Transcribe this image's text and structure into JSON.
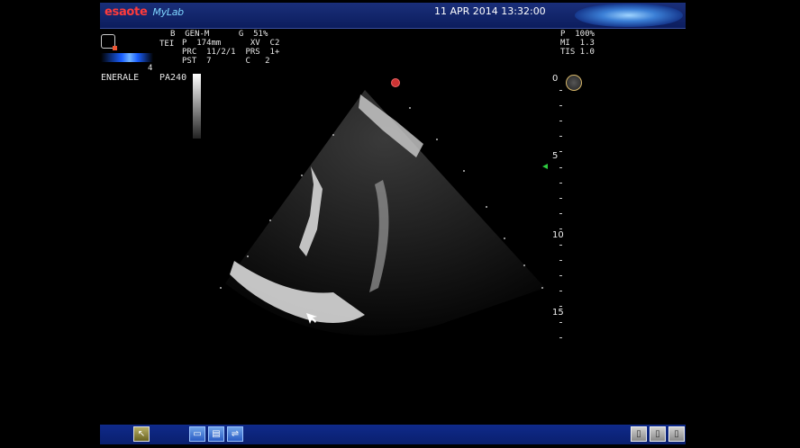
{
  "header": {
    "brand": "esaote",
    "brand_product": "MyLab",
    "datetime": "11 APR 2014 13:32:00"
  },
  "params_left": {
    "probe_label": "TEI",
    "count": "4",
    "preset": "ENERALE",
    "probe_model": "PA240"
  },
  "params_main": {
    "line1": "B  GEN-M      G  51%",
    "line2": "P  174mm      XV  C2",
    "line3": "PRC  11/2/1  PRS  1+",
    "line4": "PST  7       C   2"
  },
  "params_right": {
    "line1": "P  100%",
    "line2": "MI  1.3",
    "line3": "TIS 1.0"
  },
  "depth_scale": {
    "labels": [
      "0",
      "5",
      "10",
      "15"
    ]
  },
  "icons": {
    "probe": "probe-heart-icon",
    "orientation": "orientation-marker-icon",
    "focus": "focus-marker-icon",
    "cursor": "cursor-arrow-icon",
    "tools": [
      "image-tool-icon",
      "settings-tool-icon",
      "usb-icon"
    ],
    "right_tools": [
      "doc-icon-1",
      "doc-icon-2",
      "doc-icon-3"
    ]
  },
  "colors": {
    "header_bg": "#0c1d5e",
    "accent_red": "#ff3b3b",
    "focus_green": "#2ecc40"
  }
}
